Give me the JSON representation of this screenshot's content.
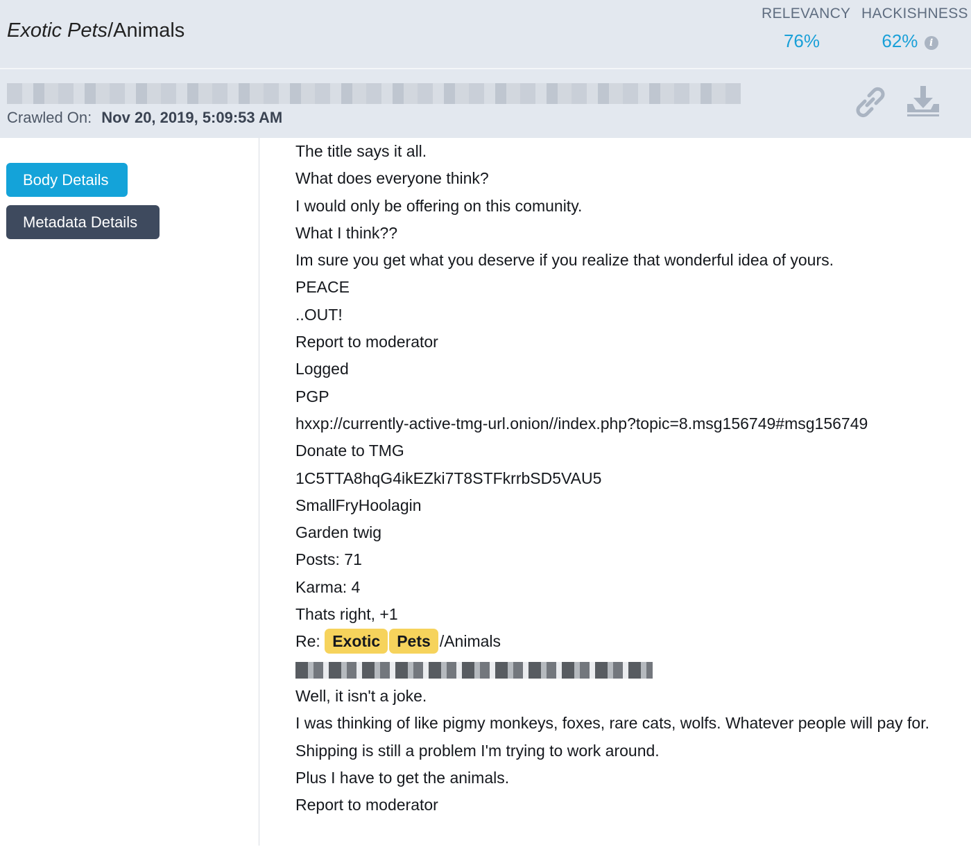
{
  "header": {
    "title_italic": "Exotic Pets",
    "title_rest": "/Animals",
    "relevancy": {
      "label": "RELEVANCY",
      "value": "76%"
    },
    "hackishness": {
      "label": "HACKISHNESS",
      "value": "62%",
      "icon": "info-icon"
    }
  },
  "subheader": {
    "crawled_label": "Crawled On:",
    "crawled_date": "Nov 20, 2019, 5:09:53 AM",
    "actions": [
      "link-icon",
      "download-icon"
    ]
  },
  "sidebar": {
    "body_details_label": "Body Details",
    "metadata_details_label": "Metadata Details"
  },
  "body": {
    "lines_before": [
      "The title says it all.",
      "What does everyone think?",
      "I would only be offering on this comunity.",
      "What I think??",
      "Im sure you get what you deserve if you realize that wonderful idea of yours.",
      "PEACE",
      " ..OUT!",
      "Report to moderator",
      "Logged",
      "PGP",
      "hxxp://currently-active-tmg-url.onion//index.php?topic=8.msg156749#msg156749",
      "Donate to TMG",
      "1C5TTA8hqG4ikEZki7T8STFkrrbSD5VAU5",
      "SmallFryHoolagin",
      "Garden twig",
      "Posts: 71",
      "Karma: 4",
      "Thats right, +1"
    ],
    "re_line": {
      "prefix": "Re:",
      "tag1": "Exotic",
      "tag2": "Pets",
      "suffix": "/Animals"
    },
    "lines_after": [
      "Well, it isn't a joke.",
      "I was thinking of like pigmy monkeys, foxes, rare cats, wolfs. Whatever people will pay for.",
      "Shipping is still a problem I'm trying to work around.",
      "Plus I have to get the animals.",
      "Report to moderator"
    ]
  },
  "colors": {
    "accent": "#14a3d9",
    "header_bg": "#e3e8ef",
    "tag": "#f6d35c",
    "dark_button": "#3e4a5e"
  }
}
